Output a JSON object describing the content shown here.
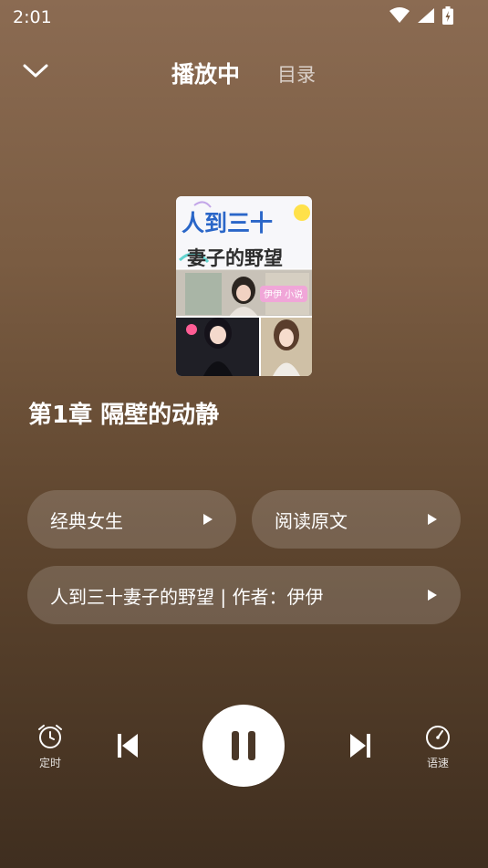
{
  "status": {
    "time": "2:01"
  },
  "header": {
    "title": "播放中",
    "toc_label": "目录"
  },
  "book": {
    "cover_title_line1": "人到三十",
    "cover_title_line2": "妻子的野望",
    "cover_author": "伊伊 小说"
  },
  "chapter_title": "第1章 隔壁的动静",
  "pills": {
    "voice_label": "经典女生",
    "read_original_label": "阅读原文",
    "book_info_label": "人到三十妻子的野望 | 作者：伊伊"
  },
  "controls": {
    "timer_label": "定时",
    "speed_label": "语速"
  },
  "colors": {
    "accent_text": "#ffffff",
    "pause_bg": "#ffffff",
    "pause_icon": "#4a3727"
  }
}
